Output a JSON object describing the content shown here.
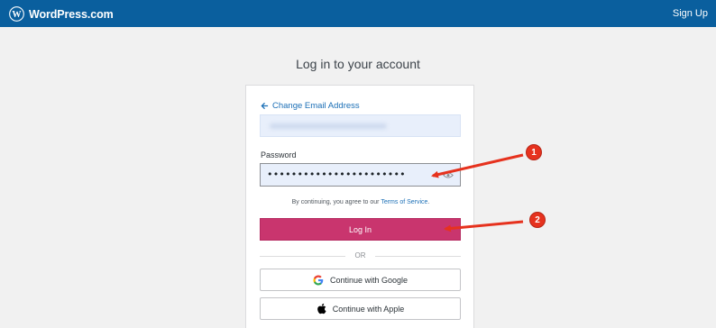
{
  "header": {
    "brand_name": "WordPress.com",
    "signup_label": "Sign Up",
    "background_color": "#0a5f9e"
  },
  "page": {
    "heading": "Log in to your account"
  },
  "form": {
    "back_link_label": "Change Email Address",
    "password_label": "Password",
    "password_masked": "•••••••••••••••••••••••",
    "terms_prefix": "By continuing, you agree to our ",
    "terms_link": "Terms of Service",
    "terms_suffix": ".",
    "login_button": "Log In",
    "login_button_color": "#c9356e",
    "or_text": "OR",
    "google_button": "Continue with Google",
    "apple_button": "Continue with Apple"
  },
  "annotations": {
    "markers": [
      "1",
      "2"
    ],
    "color": "#e6321e"
  }
}
